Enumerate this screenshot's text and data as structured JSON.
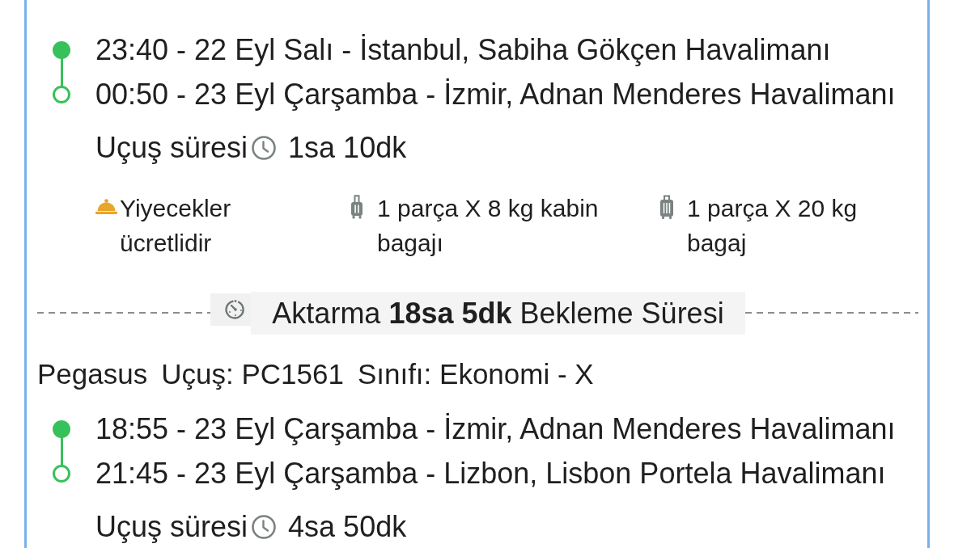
{
  "itinerary": [
    {
      "kind": "flight",
      "stops": [
        {
          "kind": "departure",
          "text": "23:40 - 22 Eyl Salı - İstanbul, Sabiha Gökçen Havalimanı"
        },
        {
          "kind": "arrival",
          "text": "00:50 - 23 Eyl Çarşamba - İzmir, Adnan Menderes Havalimanı"
        }
      ],
      "duration_label": "Uçuş süresi",
      "duration": "1sa 10dk",
      "amenities": [
        {
          "kind": "meal",
          "text": "Yiyecekler ücretlidir"
        },
        {
          "kind": "cabin_bag",
          "text": "1 parça X 8 kg kabin bagajı"
        },
        {
          "kind": "checked_bag",
          "text": "1 parça X 20 kg bagaj"
        }
      ]
    },
    {
      "kind": "layover",
      "text": "Aktarma **18sa 5dk** Bekleme Süresi"
    },
    {
      "kind": "flight",
      "header": {
        "airline": "Pegasus",
        "flight": "Uçuş: PC1561",
        "fare_class": "Sınıfı: Ekonomi - X"
      },
      "stops": [
        {
          "kind": "departure",
          "text": "18:55 - 23 Eyl Çarşamba - İzmir, Adnan Menderes Havalimanı"
        },
        {
          "kind": "arrival",
          "text": "21:45 - 23 Eyl Çarşamba - Lizbon, Lisbon Portela Havalimanı"
        }
      ],
      "duration_label": "Uçuş süresi",
      "duration": "4sa 50dk"
    }
  ]
}
